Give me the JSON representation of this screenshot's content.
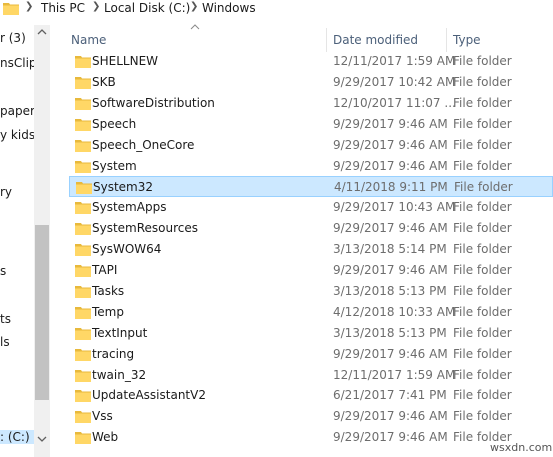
{
  "address": {
    "segments": [
      "This PC",
      "Local Disk (C:)",
      "Windows"
    ]
  },
  "nav": {
    "items": [
      "r (3)",
      "nsClipa",
      "paper",
      "y kids",
      "ry",
      "s",
      "ts",
      "ls",
      ": (C:)"
    ],
    "selected_index": 8
  },
  "columns": {
    "name": "Name",
    "date": "Date modified",
    "type": "Type"
  },
  "files": [
    {
      "name": "SHELLNEW",
      "date": "12/11/2017 1:59 AM",
      "type": "File folder"
    },
    {
      "name": "SKB",
      "date": "9/29/2017 10:42 AM",
      "type": "File folder"
    },
    {
      "name": "SoftwareDistribution",
      "date": "12/10/2017 11:07 ...",
      "type": "File folder"
    },
    {
      "name": "Speech",
      "date": "9/29/2017 9:46 AM",
      "type": "File folder"
    },
    {
      "name": "Speech_OneCore",
      "date": "9/29/2017 9:46 AM",
      "type": "File folder"
    },
    {
      "name": "System",
      "date": "9/29/2017 9:46 AM",
      "type": "File folder"
    },
    {
      "name": "System32",
      "date": "4/11/2018 9:11 PM",
      "type": "File folder"
    },
    {
      "name": "SystemApps",
      "date": "9/29/2017 10:43 AM",
      "type": "File folder"
    },
    {
      "name": "SystemResources",
      "date": "9/29/2017 9:46 AM",
      "type": "File folder"
    },
    {
      "name": "SysWOW64",
      "date": "3/13/2018 5:14 PM",
      "type": "File folder"
    },
    {
      "name": "TAPI",
      "date": "9/29/2017 9:46 AM",
      "type": "File folder"
    },
    {
      "name": "Tasks",
      "date": "3/13/2018 5:13 PM",
      "type": "File folder"
    },
    {
      "name": "Temp",
      "date": "4/12/2018 10:33 AM",
      "type": "File folder"
    },
    {
      "name": "TextInput",
      "date": "3/13/2018 5:13 PM",
      "type": "File folder"
    },
    {
      "name": "tracing",
      "date": "9/29/2017 9:46 AM",
      "type": "File folder"
    },
    {
      "name": "twain_32",
      "date": "12/11/2017 1:59 AM",
      "type": "File folder"
    },
    {
      "name": "UpdateAssistantV2",
      "date": "6/21/2017 7:41 PM",
      "type": "File folder"
    },
    {
      "name": "Vss",
      "date": "9/29/2017 9:46 AM",
      "type": "File folder"
    },
    {
      "name": "Web",
      "date": "9/29/2017 9:46 AM",
      "type": "File folder"
    }
  ],
  "selected_file_index": 6,
  "watermark": "wsxdn.com",
  "colors": {
    "folder_fill": "#ffd766",
    "folder_tab": "#e8b93c",
    "selection": "#cce8ff",
    "selection_border": "#99d1ff",
    "header_text": "#4c607a"
  },
  "icons": {
    "folder": "folder-icon",
    "separator": "chevron-right-icon",
    "sort": "sort-up-icon"
  }
}
